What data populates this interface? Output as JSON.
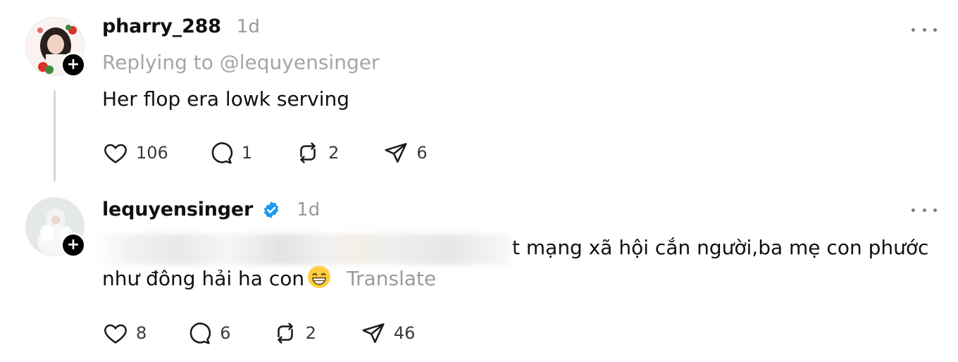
{
  "post1": {
    "username": "pharry_288",
    "time": "1d",
    "replying_to": "Replying to @lequyensinger",
    "text": "Her flop era lowk serving",
    "likes": "106",
    "comments": "1",
    "reposts": "2",
    "shares": "6"
  },
  "post2": {
    "username": "lequyensinger",
    "verified": true,
    "time": "1d",
    "text_visible": "t mạng xã hội cắn người,ba mẹ con phước",
    "text_line2": "như đông hải ha con",
    "emoji": "grinning-face-with-smiling-eyes",
    "translate_label": "Translate",
    "likes": "8",
    "comments": "6",
    "reposts": "2",
    "shares": "46"
  },
  "colors": {
    "verified": "#1d9bf0",
    "muted": "#9a9a9a",
    "thread_line": "#d6d6d6"
  }
}
